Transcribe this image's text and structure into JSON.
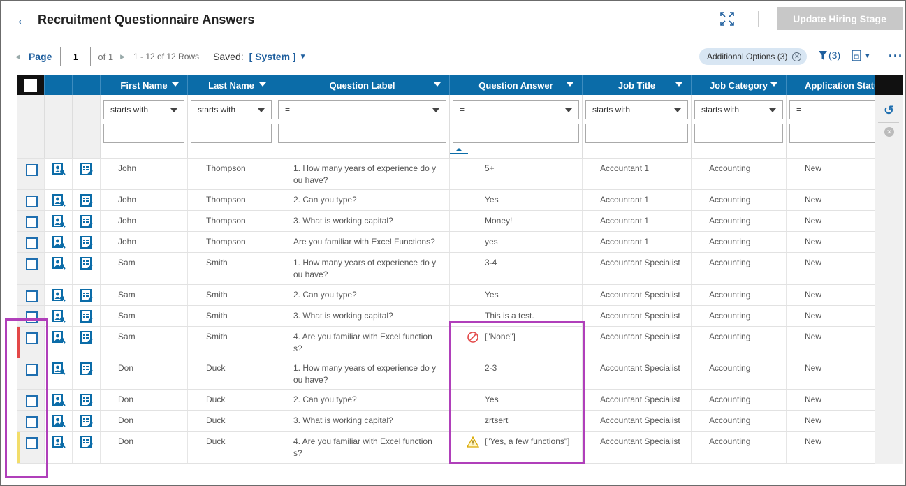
{
  "header": {
    "title": "Recruitment Questionnaire Answers",
    "update_button": "Update Hiring Stage"
  },
  "pager": {
    "page_label": "Page",
    "page_value": "1",
    "of_label": "of 1",
    "rows_label": "1 - 12 of 12 Rows",
    "saved_label": "Saved:",
    "saved_view": "[ System ]"
  },
  "toolbar": {
    "additional_options": "Additional Options (3)",
    "filter_count": "(3)"
  },
  "columns": [
    {
      "label": "First Name",
      "filter_op": "starts with"
    },
    {
      "label": "Last Name",
      "filter_op": "starts with"
    },
    {
      "label": "Question Label",
      "filter_op": "="
    },
    {
      "label": "Question Answer",
      "filter_op": "="
    },
    {
      "label": "Job Title",
      "filter_op": "starts with"
    },
    {
      "label": "Job Category",
      "filter_op": "starts with"
    },
    {
      "label": "Application Status",
      "filter_op": "="
    }
  ],
  "rows": [
    {
      "first": "John",
      "last": "Thompson",
      "question": "1. How many years of experience do y\nou have?",
      "answer": "5+",
      "title": "Accountant 1",
      "category": "Accounting",
      "status": "New",
      "flag": ""
    },
    {
      "first": "John",
      "last": "Thompson",
      "question": "2. Can you type?",
      "answer": "Yes",
      "title": "Accountant 1",
      "category": "Accounting",
      "status": "New",
      "flag": ""
    },
    {
      "first": "John",
      "last": "Thompson",
      "question": "3. What is working capital?",
      "answer": "Money!",
      "title": "Accountant 1",
      "category": "Accounting",
      "status": "New",
      "flag": ""
    },
    {
      "first": "John",
      "last": "Thompson",
      "question": "Are you familiar with Excel Functions?",
      "answer": "yes",
      "title": "Accountant 1",
      "category": "Accounting",
      "status": "New",
      "flag": ""
    },
    {
      "first": "Sam",
      "last": "Smith",
      "question": "1. How many years of experience do y\nou have?",
      "answer": "3-4",
      "title": "Accountant Specialist",
      "category": "Accounting",
      "status": "New",
      "flag": ""
    },
    {
      "first": "Sam",
      "last": "Smith",
      "question": "2. Can you type?",
      "answer": "Yes",
      "title": "Accountant Specialist",
      "category": "Accounting",
      "status": "New",
      "flag": ""
    },
    {
      "first": "Sam",
      "last": "Smith",
      "question": "3. What is working capital?",
      "answer": "This is a test.",
      "title": "Accountant Specialist",
      "category": "Accounting",
      "status": "New",
      "flag": ""
    },
    {
      "first": "Sam",
      "last": "Smith",
      "question": "4. Are you familiar with Excel function\ns?",
      "answer": "[\"None\"]",
      "title": "Accountant Specialist",
      "category": "Accounting",
      "status": "New",
      "flag": "error"
    },
    {
      "first": "Don",
      "last": "Duck",
      "question": "1. How many years of experience do y\nou have?",
      "answer": "2-3",
      "title": "Accountant Specialist",
      "category": "Accounting",
      "status": "New",
      "flag": ""
    },
    {
      "first": "Don",
      "last": "Duck",
      "question": "2. Can you type?",
      "answer": "Yes",
      "title": "Accountant Specialist",
      "category": "Accounting",
      "status": "New",
      "flag": ""
    },
    {
      "first": "Don",
      "last": "Duck",
      "question": "3. What is working capital?",
      "answer": "zrtsert",
      "title": "Accountant Specialist",
      "category": "Accounting",
      "status": "New",
      "flag": ""
    },
    {
      "first": "Don",
      "last": "Duck",
      "question": "4. Are you familiar with Excel function\ns?",
      "answer": "[\"Yes, a few functions\"]",
      "title": "Accountant Specialist",
      "category": "Accounting",
      "status": "New",
      "flag": "warning"
    }
  ],
  "colors": {
    "header_blue": "#0b6ca8",
    "link_blue": "#1f5f9e",
    "highlight": "#b03fba",
    "error": "#e34848",
    "warning": "#f2dd6a"
  },
  "icons": [
    "back-arrow-icon",
    "expand-icon",
    "filter-icon",
    "export-icon",
    "more-icon",
    "view-candidate-icon",
    "view-form-icon",
    "undo-icon",
    "clear-filter-icon",
    "error-icon",
    "warning-icon"
  ]
}
